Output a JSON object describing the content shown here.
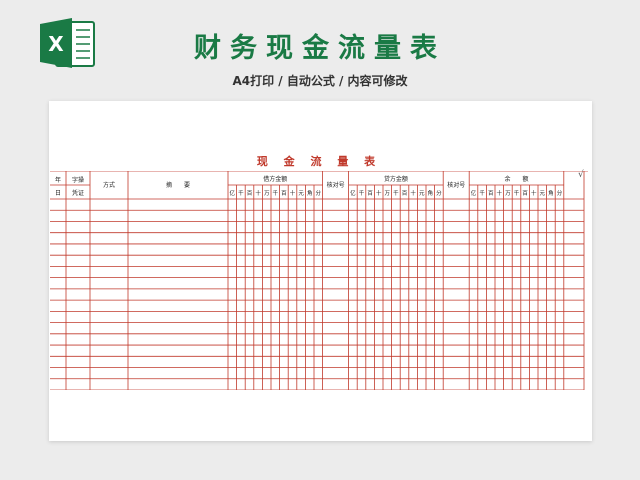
{
  "header": {
    "title": "财务现金流量表",
    "subtitle": "A4打印 / 自动公式 / 内容可修改",
    "logo_letter": "X"
  },
  "ledger": {
    "title": "现 金 流 量 表",
    "check_mark": "√",
    "col_year": "年",
    "col_day": "日",
    "col_voucher_no": "字操",
    "col_voucher": "凭证",
    "col_method": "方式",
    "col_summary": "摘　　要",
    "debit_label": "借方金额",
    "credit_label": "贷方金额",
    "balance_label": "余　　额",
    "check_no": "核对号",
    "digits": [
      "亿",
      "千",
      "百",
      "十",
      "万",
      "千",
      "百",
      "十",
      "元",
      "角",
      "分"
    ],
    "empty_rows": 17
  },
  "colors": {
    "brand_green": "#1a7a45",
    "grid_red": "#c0392b"
  }
}
